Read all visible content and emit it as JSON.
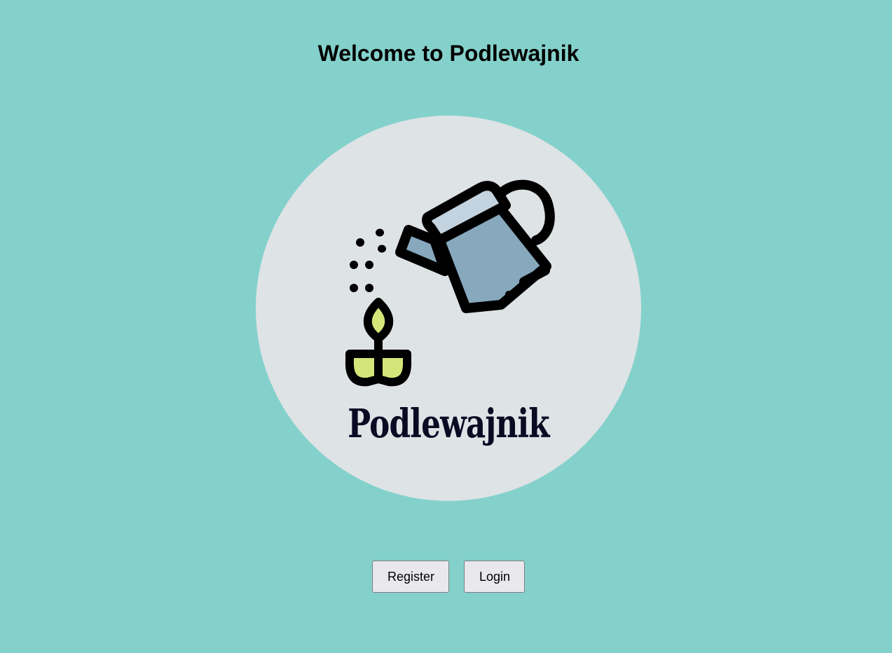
{
  "header": {
    "title": "Welcome to Podlewajnik"
  },
  "logo": {
    "wordmark": "Podlewajnik",
    "icon": "watering-can-plant-icon",
    "colors": {
      "circle_bg": "#dee3e6",
      "can_body": "#87a8bd",
      "can_top": "#c3d3df",
      "leaf": "#d4e67a",
      "outline": "#000000",
      "wordmark": "#0a0a23"
    }
  },
  "actions": {
    "register_label": "Register",
    "login_label": "Login"
  },
  "theme": {
    "background": "#84d1cb",
    "button_bg": "#e9e8ed",
    "button_border": "#7d7d82"
  }
}
